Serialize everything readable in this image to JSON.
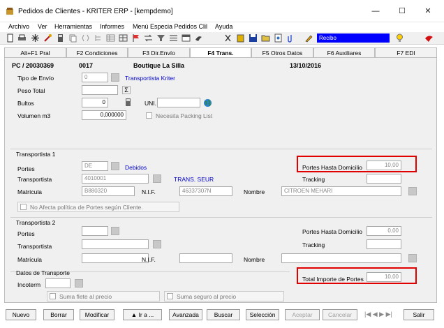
{
  "window": {
    "title": "Pedidos de Clientes - KRITER ERP - [kempdemo]",
    "minimize": "—",
    "maximize": "☐",
    "close": "✕"
  },
  "menu": [
    "Archivo",
    "Ver",
    "Herramientas",
    "Informes",
    "Menú Especia Pedidos Clil",
    "Ayuda"
  ],
  "toolbar": {
    "report_select": "Recibo"
  },
  "tabs": [
    "Alt+F1 Pral",
    "F2 Condiciones",
    "F3 Dir.Envío",
    "F4 Trans.",
    "F5 Otros Datos",
    "F6 Auxiliares",
    "F7 EDI"
  ],
  "header": {
    "order_id": "PC / 20030369",
    "client_code": "0017",
    "client_name": "Boutique La Silla",
    "date": "13/10/2016"
  },
  "envio": {
    "tipo_label": "Tipo de Envío",
    "tipo_value": "0",
    "tipo_desc": "Transportista Kriter",
    "peso_label": "Peso Total",
    "peso_value": "",
    "bultos_label": "Bultos",
    "bultos_value": "0",
    "uni_label": "UNI.",
    "uni_value": "",
    "volumen_label": "Volumen m3",
    "volumen_value": "0,000000",
    "packing_label": "Necesita Packing List"
  },
  "transportista1": {
    "title": "Transportista 1",
    "portes_label": "Portes",
    "portes_value": "DE",
    "portes_desc": "Debidos",
    "phd_label": "Portes Hasta Domicilio",
    "phd_value": "10,00",
    "transportista_label": "Transportista",
    "transportista_value": "4010001",
    "transportista_name": "TRANS. SEUR",
    "tracking_label": "Tracking",
    "tracking_value": "",
    "matricula_label": "Matrícula",
    "matricula_value": "B880320",
    "nif_label": "N.I.F.",
    "nif_value": "46337307N",
    "nombre_label": "Nombre",
    "nombre_value": "CITROEN MEHARI",
    "no_afecta_label": "No Afecta política de Portes según Cliente."
  },
  "transportista2": {
    "title": "Transportista 2",
    "portes_label": "Portes",
    "portes_value": "",
    "phd_label": "Portes Hasta Domicilio",
    "phd_value": "0,00",
    "transportista_label": "Transportista",
    "transportista_value": "",
    "tracking_label": "Tracking",
    "tracking_value": "",
    "matricula_label": "Matrícula",
    "matricula_value": "",
    "nif_label": "N.I.F.",
    "nif_value": "",
    "nombre_label": "Nombre",
    "nombre_value": ""
  },
  "datos_transporte": {
    "title": "Datos de Transporte",
    "incoterm_label": "Incoterm",
    "incoterm_value": "",
    "suma_flete_label": "Suma flete al precio",
    "suma_seguro_label": "Suma seguro al precio",
    "total_label": "Total Importe de Portes",
    "total_value": "10,00"
  },
  "buttons": {
    "nuevo": "Nuevo",
    "borrar": "Borrar",
    "modificar": "Modificar",
    "ira": "▲ Ir a ...",
    "avanzada": "Avanzada",
    "buscar": "Buscar",
    "seleccion": "Selección",
    "aceptar": "Aceptar",
    "cancelar": "Cancelar",
    "salir": "Salir"
  },
  "pager": "|◀ ◀ ▶ ▶|"
}
